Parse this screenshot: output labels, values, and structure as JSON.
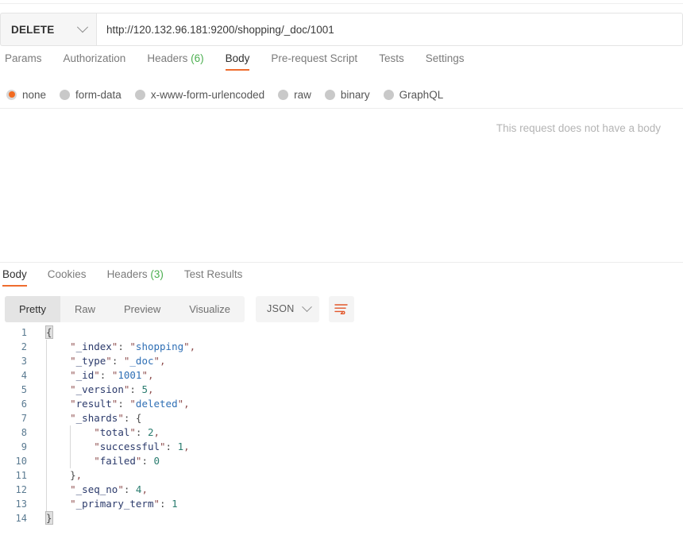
{
  "request": {
    "method": "DELETE",
    "url": "http://120.132.96.181:9200/shopping/_doc/1001",
    "tabs": [
      {
        "label": "Params",
        "active": false,
        "count": null
      },
      {
        "label": "Authorization",
        "active": false,
        "count": null
      },
      {
        "label": "Headers",
        "active": false,
        "count": "(6)"
      },
      {
        "label": "Body",
        "active": true,
        "count": null
      },
      {
        "label": "Pre-request Script",
        "active": false,
        "count": null
      },
      {
        "label": "Tests",
        "active": false,
        "count": null
      },
      {
        "label": "Settings",
        "active": false,
        "count": null
      }
    ],
    "body_types": [
      {
        "label": "none",
        "selected": true
      },
      {
        "label": "form-data",
        "selected": false
      },
      {
        "label": "x-www-form-urlencoded",
        "selected": false
      },
      {
        "label": "raw",
        "selected": false
      },
      {
        "label": "binary",
        "selected": false
      },
      {
        "label": "GraphQL",
        "selected": false
      }
    ],
    "empty_body_message": "This request does not have a body"
  },
  "response": {
    "tabs": [
      {
        "label": "Body",
        "active": true,
        "count": null
      },
      {
        "label": "Cookies",
        "active": false,
        "count": null
      },
      {
        "label": "Headers",
        "active": false,
        "count": "(3)"
      },
      {
        "label": "Test Results",
        "active": false,
        "count": null
      }
    ],
    "view_modes": [
      {
        "label": "Pretty",
        "active": true
      },
      {
        "label": "Raw",
        "active": false
      },
      {
        "label": "Preview",
        "active": false
      },
      {
        "label": "Visualize",
        "active": false
      }
    ],
    "format": "JSON",
    "wrap_icon": "word-wrap-icon",
    "body_json": {
      "_index": "shopping",
      "_type": "_doc",
      "_id": "1001",
      "_version": 5,
      "result": "deleted",
      "_shards": {
        "total": 2,
        "successful": 1,
        "failed": 0
      },
      "_seq_no": 4,
      "_primary_term": 1
    },
    "code_lines": [
      {
        "n": 1,
        "indent": 0,
        "tokens": [
          {
            "t": "brace",
            "v": "{",
            "hl": true
          }
        ]
      },
      {
        "n": 2,
        "indent": 1,
        "tokens": [
          {
            "t": "punct",
            "v": "\""
          },
          {
            "t": "key",
            "v": "_index"
          },
          {
            "t": "punct",
            "v": "\""
          },
          {
            "t": "brace",
            "v": ": "
          },
          {
            "t": "punct",
            "v": "\""
          },
          {
            "t": "str",
            "v": "shopping"
          },
          {
            "t": "punct",
            "v": "\""
          },
          {
            "t": "comma",
            "v": ","
          }
        ]
      },
      {
        "n": 3,
        "indent": 1,
        "tokens": [
          {
            "t": "punct",
            "v": "\""
          },
          {
            "t": "key",
            "v": "_type"
          },
          {
            "t": "punct",
            "v": "\""
          },
          {
            "t": "brace",
            "v": ": "
          },
          {
            "t": "punct",
            "v": "\""
          },
          {
            "t": "str",
            "v": "_doc"
          },
          {
            "t": "punct",
            "v": "\""
          },
          {
            "t": "comma",
            "v": ","
          }
        ]
      },
      {
        "n": 4,
        "indent": 1,
        "tokens": [
          {
            "t": "punct",
            "v": "\""
          },
          {
            "t": "key",
            "v": "_id"
          },
          {
            "t": "punct",
            "v": "\""
          },
          {
            "t": "brace",
            "v": ": "
          },
          {
            "t": "punct",
            "v": "\""
          },
          {
            "t": "str",
            "v": "1001"
          },
          {
            "t": "punct",
            "v": "\""
          },
          {
            "t": "comma",
            "v": ","
          }
        ]
      },
      {
        "n": 5,
        "indent": 1,
        "tokens": [
          {
            "t": "punct",
            "v": "\""
          },
          {
            "t": "key",
            "v": "_version"
          },
          {
            "t": "punct",
            "v": "\""
          },
          {
            "t": "brace",
            "v": ": "
          },
          {
            "t": "num",
            "v": "5"
          },
          {
            "t": "comma",
            "v": ","
          }
        ]
      },
      {
        "n": 6,
        "indent": 1,
        "tokens": [
          {
            "t": "punct",
            "v": "\""
          },
          {
            "t": "key",
            "v": "result"
          },
          {
            "t": "punct",
            "v": "\""
          },
          {
            "t": "brace",
            "v": ": "
          },
          {
            "t": "punct",
            "v": "\""
          },
          {
            "t": "str",
            "v": "deleted"
          },
          {
            "t": "punct",
            "v": "\""
          },
          {
            "t": "comma",
            "v": ","
          }
        ]
      },
      {
        "n": 7,
        "indent": 1,
        "tokens": [
          {
            "t": "punct",
            "v": "\""
          },
          {
            "t": "key",
            "v": "_shards"
          },
          {
            "t": "punct",
            "v": "\""
          },
          {
            "t": "brace",
            "v": ": "
          },
          {
            "t": "brace",
            "v": "{"
          }
        ]
      },
      {
        "n": 8,
        "indent": 2,
        "tokens": [
          {
            "t": "punct",
            "v": "\""
          },
          {
            "t": "key",
            "v": "total"
          },
          {
            "t": "punct",
            "v": "\""
          },
          {
            "t": "brace",
            "v": ": "
          },
          {
            "t": "num",
            "v": "2"
          },
          {
            "t": "comma",
            "v": ","
          }
        ]
      },
      {
        "n": 9,
        "indent": 2,
        "tokens": [
          {
            "t": "punct",
            "v": "\""
          },
          {
            "t": "key",
            "v": "successful"
          },
          {
            "t": "punct",
            "v": "\""
          },
          {
            "t": "brace",
            "v": ": "
          },
          {
            "t": "num",
            "v": "1"
          },
          {
            "t": "comma",
            "v": ","
          }
        ]
      },
      {
        "n": 10,
        "indent": 2,
        "tokens": [
          {
            "t": "punct",
            "v": "\""
          },
          {
            "t": "key",
            "v": "failed"
          },
          {
            "t": "punct",
            "v": "\""
          },
          {
            "t": "brace",
            "v": ": "
          },
          {
            "t": "num",
            "v": "0"
          }
        ]
      },
      {
        "n": 11,
        "indent": 1,
        "tokens": [
          {
            "t": "brace",
            "v": "}"
          },
          {
            "t": "comma",
            "v": ","
          }
        ]
      },
      {
        "n": 12,
        "indent": 1,
        "tokens": [
          {
            "t": "punct",
            "v": "\""
          },
          {
            "t": "key",
            "v": "_seq_no"
          },
          {
            "t": "punct",
            "v": "\""
          },
          {
            "t": "brace",
            "v": ": "
          },
          {
            "t": "num",
            "v": "4"
          },
          {
            "t": "comma",
            "v": ","
          }
        ]
      },
      {
        "n": 13,
        "indent": 1,
        "tokens": [
          {
            "t": "punct",
            "v": "\""
          },
          {
            "t": "key",
            "v": "_primary_term"
          },
          {
            "t": "punct",
            "v": "\""
          },
          {
            "t": "brace",
            "v": ": "
          },
          {
            "t": "num",
            "v": "1"
          }
        ]
      },
      {
        "n": 14,
        "indent": 0,
        "tokens": [
          {
            "t": "brace",
            "v": "}",
            "hl": true
          }
        ]
      }
    ]
  },
  "colors": {
    "accent": "#ef6c2e",
    "radio_selected": "#f26b21",
    "count_green": "#4caf50",
    "json_key": "#2b3a6b",
    "json_string": "#2f6fb5",
    "json_number": "#2a7c6f",
    "json_punct": "#8f4f4f"
  }
}
